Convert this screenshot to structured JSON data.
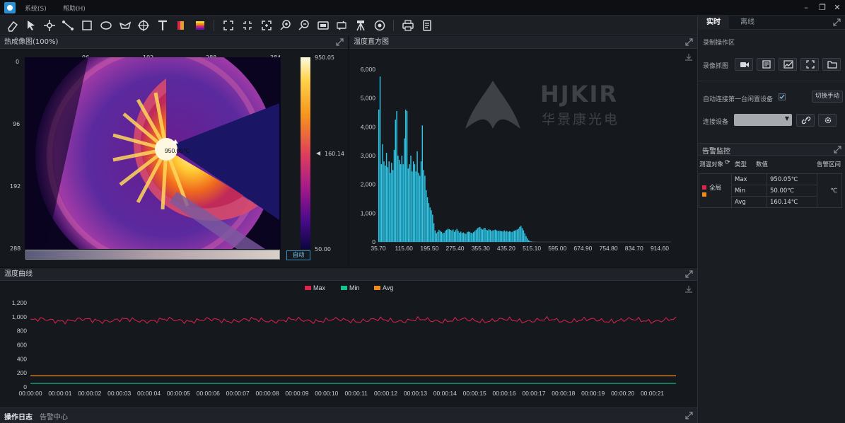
{
  "menu": {
    "system": "系统(S)",
    "help": "帮助(H)"
  },
  "thermal": {
    "title": "热成像图(100%)",
    "x_ticks": [
      "96",
      "192",
      "288",
      "384"
    ],
    "y_ticks": [
      "0",
      "96",
      "192",
      "288"
    ],
    "scale_max": "950.05",
    "scale_mid": "160.14",
    "scale_min": "50.00",
    "hotspot_label": "950.05℃",
    "auto_button": "自动"
  },
  "histogram_panel": {
    "title": "温度直方图",
    "watermark_brand": "HJKIR",
    "watermark_sub": "华景康光电"
  },
  "curve_panel": {
    "title": "温度曲线"
  },
  "right_panel": {
    "tab_realtime": "实时",
    "tab_offline": "离线",
    "record_section": "录制操作区",
    "record_label": "录像抓图",
    "auto_connect_label": "自动连接第一台闲置设备",
    "switch_manual": "切换手动",
    "connect_label": "连接设备",
    "alarm_title": "告警监控",
    "alarm_col_target": "测温对象",
    "alarm_col_type": "类型",
    "alarm_col_value": "数值",
    "alarm_col_range": "告警区间",
    "alarm_target": "全局",
    "alarm_unit": "℃",
    "alarm_rows": [
      {
        "type": "Max",
        "value": "950.05℃"
      },
      {
        "type": "Min",
        "value": "50.00℃"
      },
      {
        "type": "Avg",
        "value": "160.14℃"
      }
    ]
  },
  "bottom_tabs": {
    "log": "操作日志",
    "alarm_center": "告警中心"
  },
  "colors": {
    "max": "#e0234a",
    "min": "#12c48a",
    "avg": "#f08a1c",
    "hist": "#2ec6e6"
  },
  "chart_data": [
    {
      "type": "bar",
      "title": "温度直方图",
      "x_tick_labels": [
        "35.70",
        "115.60",
        "195.50",
        "275.40",
        "355.30",
        "435.20",
        "515.10",
        "595.00",
        "674.90",
        "754.80",
        "834.70",
        "914.60"
      ],
      "x_range": [
        35.7,
        950.05
      ],
      "ylim": [
        0,
        6000
      ],
      "y_ticks": [
        0,
        1000,
        2000,
        3000,
        4000,
        5000,
        6000
      ],
      "y_tick_labels": [
        "0",
        "1,000",
        "2,000",
        "3,000",
        "4,000",
        "5,000",
        "6,000"
      ],
      "bins_start": 35.7,
      "bins_width": 4,
      "values": [
        4600,
        5750,
        2700,
        3400,
        2800,
        2650,
        3100,
        2600,
        2800,
        2400,
        2750,
        2500,
        3200,
        4250,
        4550,
        3000,
        2850,
        2700,
        3000,
        2700,
        3600,
        4600,
        4550,
        2550,
        2700,
        3000,
        2450,
        2800,
        2700,
        2450,
        3150,
        2400,
        2300,
        2800,
        4050,
        2500,
        2300,
        1800,
        1550,
        1350,
        1200,
        1100,
        950,
        650,
        400,
        300,
        350,
        420,
        380,
        350,
        300,
        320,
        390,
        420,
        460,
        440,
        420,
        400,
        430,
        350,
        410,
        450,
        380,
        320,
        360,
        310,
        330,
        300,
        280,
        340,
        360,
        350,
        320,
        300,
        340,
        380,
        420,
        480,
        500,
        520,
        460,
        430,
        470,
        490,
        420,
        400,
        440,
        420,
        380,
        400,
        410,
        430,
        400,
        380,
        390,
        380,
        370,
        360,
        400,
        360,
        380,
        350,
        370,
        360,
        340,
        380,
        390,
        410,
        430,
        460,
        520,
        560,
        480,
        400,
        300,
        200,
        120,
        60,
        30,
        15,
        8,
        5
      ]
    },
    {
      "type": "line",
      "legend": [
        "Max",
        "Min",
        "Avg"
      ],
      "x_tick_labels": [
        "00:00:00",
        "00:00:01",
        "00:00:02",
        "00:00:03",
        "00:00:04",
        "00:00:05",
        "00:00:06",
        "00:00:07",
        "00:00:08",
        "00:00:09",
        "00:00:10",
        "00:00:11",
        "00:00:12",
        "00:00:13",
        "00:00:14",
        "00:00:15",
        "00:00:16",
        "00:00:17",
        "00:00:18",
        "00:00:19",
        "00:00:20",
        "00:00:21"
      ],
      "ylim": [
        0,
        1200
      ],
      "y_ticks": [
        0,
        200,
        400,
        600,
        800,
        1000,
        1200
      ],
      "y_tick_labels": [
        "0",
        "200",
        "400",
        "600",
        "800",
        "1,000",
        "1,200"
      ],
      "t_range": [
        0,
        21.8
      ],
      "series": [
        {
          "name": "Max",
          "approx_mean": 950,
          "approx_amplitude": 60
        },
        {
          "name": "Min",
          "values_const": 50
        },
        {
          "name": "Avg",
          "values_const": 160
        }
      ]
    }
  ]
}
